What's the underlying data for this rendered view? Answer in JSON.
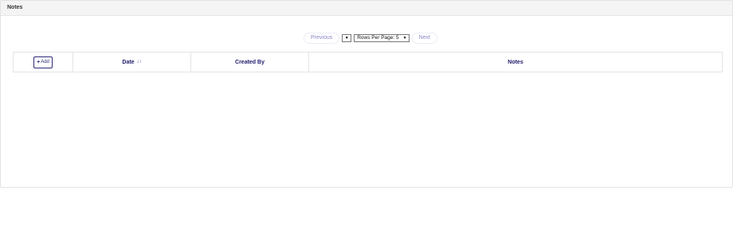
{
  "panel": {
    "title": "Notes"
  },
  "pager": {
    "previous_label": "Previous",
    "next_label": "Next",
    "page_select_value": "",
    "rows_per_page_label": "Rows Per Page: 5"
  },
  "table": {
    "add_label": "Add",
    "columns": [
      "Date",
      "Created By",
      "Notes"
    ],
    "sort_icon": "sort-asc-icon",
    "rows": []
  },
  "colors": {
    "header_bg": "#f4f4f4",
    "accent": "#2d2a7a",
    "pager_text": "#8a86c9"
  }
}
